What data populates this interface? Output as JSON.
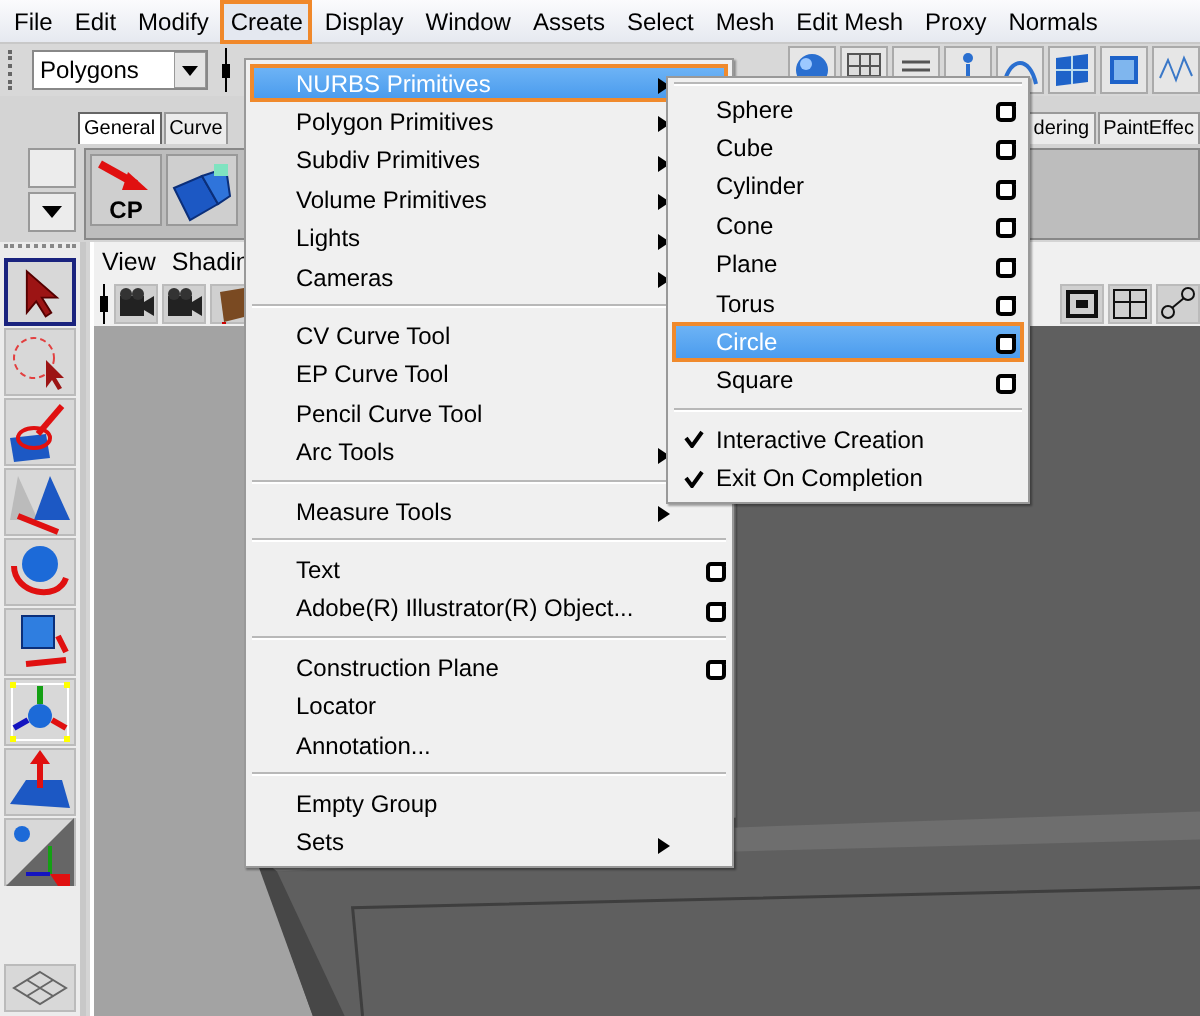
{
  "menu_bar": [
    {
      "label": "File",
      "selected": false
    },
    {
      "label": "Edit",
      "selected": false
    },
    {
      "label": "Modify",
      "selected": false
    },
    {
      "label": "Create",
      "selected": true
    },
    {
      "label": "Display",
      "selected": false
    },
    {
      "label": "Window",
      "selected": false
    },
    {
      "label": "Assets",
      "selected": false
    },
    {
      "label": "Select",
      "selected": false
    },
    {
      "label": "Mesh",
      "selected": false
    },
    {
      "label": "Edit Mesh",
      "selected": false
    },
    {
      "label": "Proxy",
      "selected": false
    },
    {
      "label": "Normals",
      "selected": false
    }
  ],
  "status_line": {
    "mode_dropdown": "Polygons"
  },
  "shelf": {
    "tabs": [
      {
        "label": "General",
        "selected": true
      },
      {
        "label": "Curve",
        "selected": false
      },
      {
        "label": "dering",
        "selected": false
      },
      {
        "label": "PaintEffec",
        "selected": false
      }
    ],
    "icon_label": "CP"
  },
  "toolbox": {
    "tools": [
      {
        "selected": true
      },
      {
        "selected": false
      },
      {
        "selected": false
      },
      {
        "selected": false
      },
      {
        "selected": false
      },
      {
        "selected": false
      },
      {
        "selected": false
      },
      {
        "selected": false
      },
      {
        "selected": false
      }
    ]
  },
  "panel": {
    "menu": [
      "View",
      "Shadin"
    ]
  },
  "create_menu": {
    "sections": [
      [
        {
          "label": "NURBS Primitives",
          "kind": "submenu",
          "selected": true
        },
        {
          "label": "Polygon Primitives",
          "kind": "submenu",
          "selected": false
        },
        {
          "label": "Subdiv Primitives",
          "kind": "submenu",
          "selected": false
        },
        {
          "label": "Volume Primitives",
          "kind": "submenu",
          "selected": false
        },
        {
          "label": "Lights",
          "kind": "submenu",
          "selected": false
        },
        {
          "label": "Cameras",
          "kind": "submenu",
          "selected": false
        }
      ],
      [
        {
          "label": "CV Curve Tool",
          "kind": "plain",
          "selected": false
        },
        {
          "label": "EP Curve Tool",
          "kind": "plain",
          "selected": false
        },
        {
          "label": "Pencil Curve Tool",
          "kind": "plain",
          "selected": false
        },
        {
          "label": "Arc Tools",
          "kind": "submenu",
          "selected": false
        }
      ],
      [
        {
          "label": "Measure Tools",
          "kind": "submenu",
          "selected": false
        }
      ],
      [
        {
          "label": "Text",
          "kind": "option",
          "selected": false
        },
        {
          "label": "Adobe(R) Illustrator(R) Object...",
          "kind": "option",
          "selected": false
        }
      ],
      [
        {
          "label": "Construction Plane",
          "kind": "option",
          "selected": false
        },
        {
          "label": "Locator",
          "kind": "plain",
          "selected": false
        },
        {
          "label": "Annotation...",
          "kind": "plain",
          "selected": false
        }
      ],
      [
        {
          "label": "Empty Group",
          "kind": "plain",
          "selected": false
        },
        {
          "label": "Sets",
          "kind": "submenu",
          "selected": false
        }
      ]
    ]
  },
  "nurbs_submenu": {
    "items": [
      {
        "label": "Sphere",
        "selected": false
      },
      {
        "label": "Cube",
        "selected": false
      },
      {
        "label": "Cylinder",
        "selected": false
      },
      {
        "label": "Cone",
        "selected": false
      },
      {
        "label": "Plane",
        "selected": false
      },
      {
        "label": "Torus",
        "selected": false
      },
      {
        "label": "Circle",
        "selected": true
      },
      {
        "label": "Square",
        "selected": false
      }
    ],
    "toggles": [
      {
        "label": "Interactive Creation",
        "checked": true
      },
      {
        "label": "Exit On Completion",
        "checked": true
      }
    ]
  }
}
